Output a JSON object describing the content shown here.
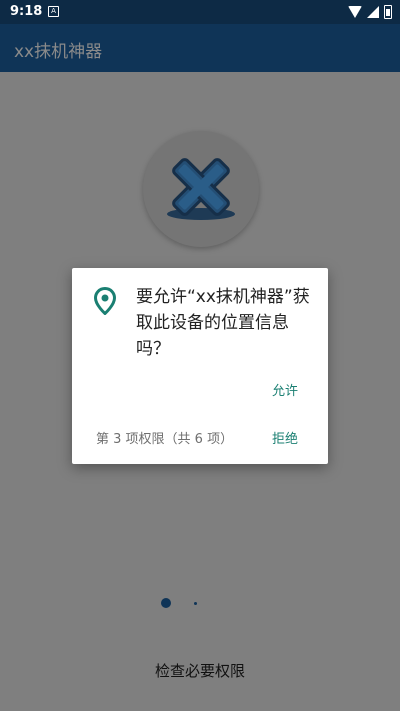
{
  "status_bar": {
    "time": "9:18",
    "notification_icon": "A"
  },
  "app_bar": {
    "title": "xx抹机神器"
  },
  "dialog": {
    "message": "要允许“xx抹机神器”获取此设备的位置信息吗？",
    "allow_label": "允许",
    "deny_label": "拒绝",
    "progress_text": "第 3 项权限（共 6 项）",
    "icon": "location-pin-icon",
    "accent_color": "#1a7f72"
  },
  "pager": {
    "current_index": 1,
    "total": 2
  },
  "footer": {
    "label": "检查必要权限"
  }
}
